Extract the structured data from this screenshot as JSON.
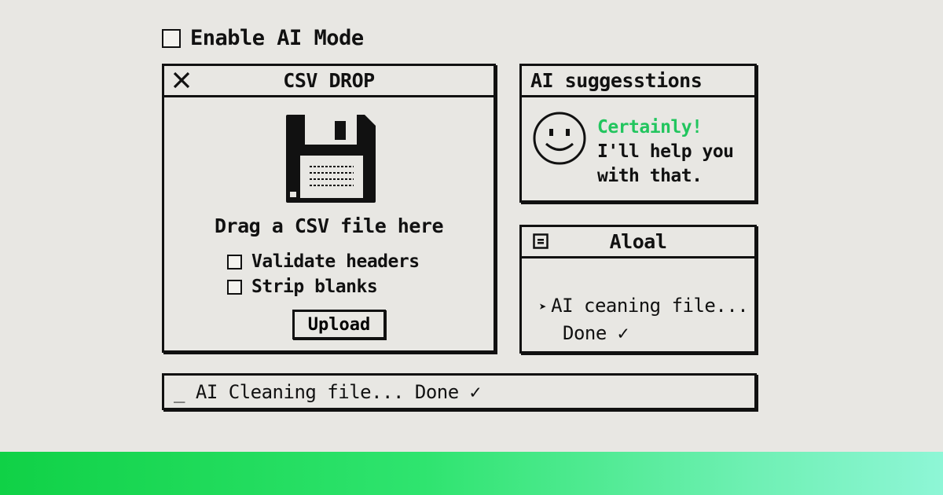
{
  "top_toggle": {
    "label": "Enable AI Mode",
    "checked": false
  },
  "csv_window": {
    "title": "CSV DROP",
    "close_icon": "close-x-icon",
    "drop_icon": "floppy-disk-icon",
    "drop_text": "Drag a CSV file here",
    "options": [
      {
        "label": "Validate headers",
        "checked": false
      },
      {
        "label": "Strip blanks",
        "checked": false
      }
    ],
    "upload_label": "Upload"
  },
  "suggestions_window": {
    "title": "AI suggesstions",
    "icon": "smiley-face-icon",
    "line1": "Certainly!",
    "line2": "I'll help you",
    "line3": "with that.",
    "accent_color": "#22c55e"
  },
  "aloal_window": {
    "title": "Aloal",
    "menu_icon": "menu-box-icon",
    "line1_prefix": "➤",
    "line1": "AI ceaning file...",
    "line2": "Done ✓"
  },
  "status_bar": {
    "text": "_ AI Cleaning file... Done ✓"
  },
  "colors": {
    "background": "#e8e7e3",
    "ink": "#111111",
    "green": "#22c55e"
  }
}
